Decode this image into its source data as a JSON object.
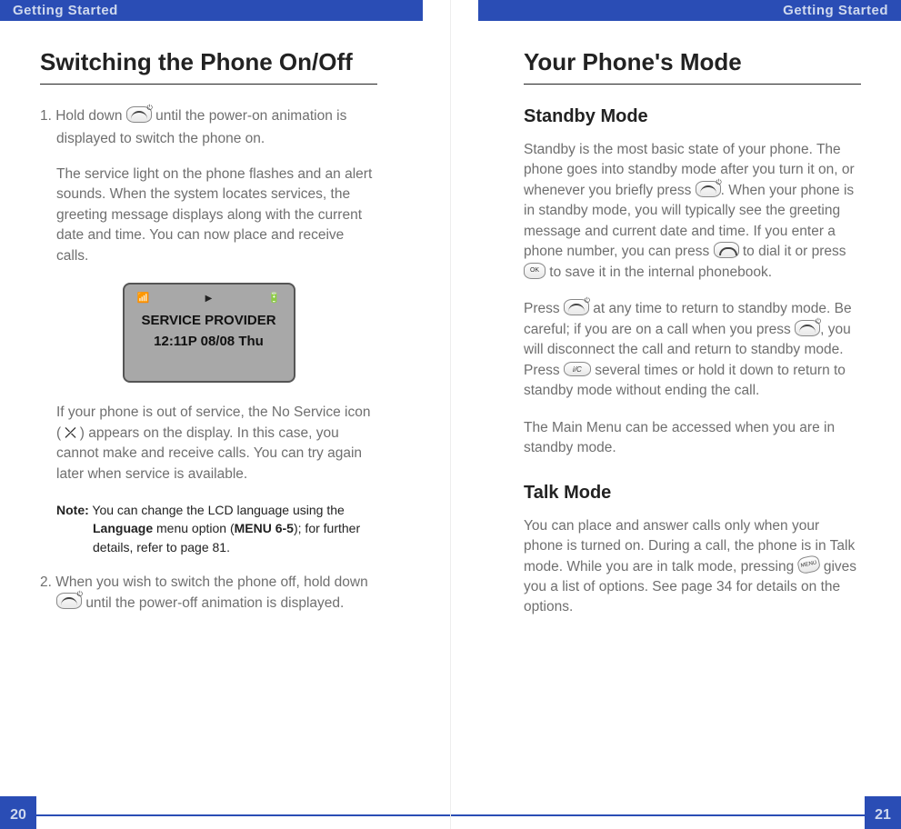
{
  "left": {
    "header": "Getting Started",
    "title": "Switching the Phone On/Off",
    "step1_a": "1. Hold down ",
    "step1_b": " until the power-on animation is",
    "step1_c": "displayed to switch the phone on.",
    "p2": "The service light on the phone flashes and an alert sounds. When the system locates services, the greeting message displays along with the current date and time. You can now place and receive calls.",
    "display": {
      "line1": "SERVICE PROVIDER",
      "line2": "12:11P 08/08 Thu"
    },
    "p3_a": "If your phone is out of service, the No Service icon ( ",
    "p3_b": " ) appears on the display. In this case, you cannot make and receive calls. You can try again later when service is available.",
    "note_label": "Note:",
    "note_body_a": " You can change the LCD language using the",
    "note_body_b": "Language",
    "note_body_c": " menu option (",
    "note_body_d": "MENU 6-5",
    "note_body_e": "); for further details, refer to page 81.",
    "step2_a": "2. When you wish to switch the phone off, hold down ",
    "step2_b": " until the power-off animation is displayed.",
    "pagenum": "20"
  },
  "right": {
    "header": "Getting Started",
    "title": "Your Phone's Mode",
    "standby_h": "Standby Mode",
    "sp1_a": "Standby is the most basic state of your phone. The phone goes into standby mode after you turn it on, or whenever you briefly press ",
    "sp1_b": ". When your phone is in standby mode, you will typically see the greeting message and current date and time. If you enter a phone number, you can press ",
    "sp1_c": " to dial it or press ",
    "sp1_d": " to save it in the internal phonebook.",
    "sp2_a": "Press ",
    "sp2_b": " at any time to return to standby mode. Be careful; if you are on a call when you press ",
    "sp2_c": ", you will disconnect the call and return to standby mode. Press ",
    "sp2_d": " several times or hold it down to return to standby mode without ending the call.",
    "sp3": "The Main Menu can be accessed when you are in standby mode.",
    "talk_h": "Talk Mode",
    "tp1_a": "You can place and answer calls only when your phone is turned on. During a call, the phone is in Talk mode. While you are in talk mode, pressing ",
    "tp1_b": " gives you a list of options. See page 34 for details on the options.",
    "pagenum": "21"
  }
}
